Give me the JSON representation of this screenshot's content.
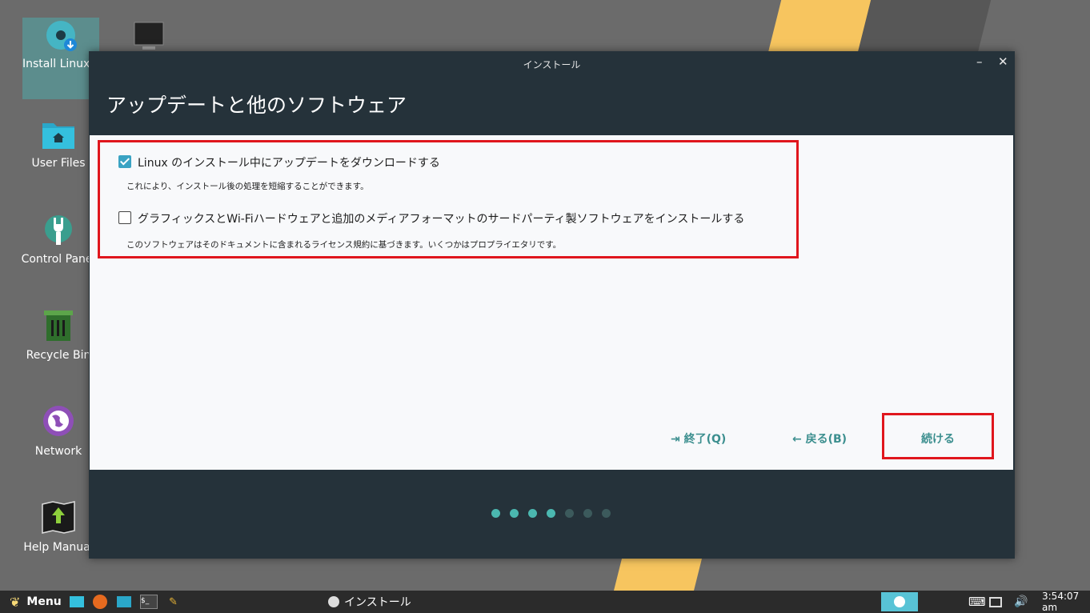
{
  "desktop": {
    "icons": [
      {
        "label": "Install Linux Lite"
      },
      {
        "label": "User Files"
      },
      {
        "label": "Control Panel"
      },
      {
        "label": "Recycle Bin"
      },
      {
        "label": "Network"
      },
      {
        "label": "Help Manual"
      }
    ]
  },
  "window": {
    "title": "インストール",
    "minimize_glyph": "–",
    "close_glyph": "✕",
    "heading": "アップデートと他のソフトウェア",
    "options": [
      {
        "label": "Linux のインストール中にアップデートをダウンロードする",
        "description": "これにより、インストール後の処理を短縮することができます。",
        "checked": true
      },
      {
        "label": "グラフィックスとWi-Fiハードウェアと追加のメディアフォーマットのサードパーティ製ソフトウェアをインストールする",
        "description": "このソフトウェアはそのドキュメントに含まれるライセンス規約に基づきます。いくつかはプロプライエタリです。",
        "checked": false
      }
    ],
    "buttons": {
      "quit": "終了(Q)",
      "back": "戻る(B)",
      "continue": "続ける"
    },
    "progress": {
      "current": 4,
      "total": 7
    },
    "colors": {
      "accent": "#3c8f8f",
      "dot_active": "#4bb8b0",
      "dot_inactive": "#3c5a5c",
      "highlight": "#e0161d"
    }
  },
  "taskbar": {
    "menu_label": "Menu",
    "task_label": "インストール",
    "clock": "3:54:07 am",
    "icons": [
      "user-files-icon",
      "firefox-icon",
      "file-manager-icon",
      "terminal-icon",
      "script-icon"
    ]
  }
}
